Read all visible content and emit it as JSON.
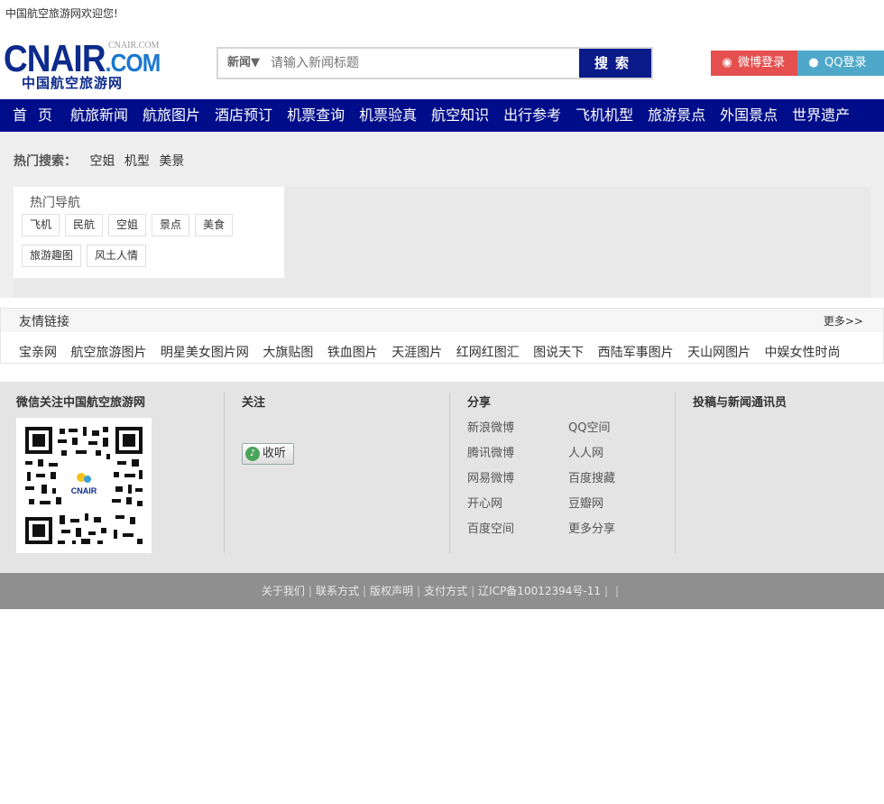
{
  "topbar": {
    "welcome": "中国航空旅游网欢迎您!"
  },
  "logo": {
    "main": "CNAIR",
    "dotcom": ".COM",
    "small": "CNAIR.COM",
    "cn": "中国航空旅游网"
  },
  "search": {
    "category": "新闻▼",
    "placeholder": "请输入新闻标题",
    "button": "搜索"
  },
  "login": {
    "weibo": "微博登录",
    "qq": "QQ登录"
  },
  "nav": [
    "首页",
    "航旅新闻",
    "航旅图片",
    "酒店预订",
    "机票查询",
    "机票验真",
    "航空知识",
    "出行参考",
    "飞机机型",
    "旅游景点",
    "外国景点",
    "世界遗产"
  ],
  "hot_search": {
    "label": "热门搜索：",
    "items": [
      "空姐",
      "机型",
      "美景"
    ]
  },
  "hot_nav": {
    "title": "热门导航",
    "tags": [
      "飞机",
      "民航",
      "空姐",
      "景点",
      "美食",
      "旅游趣图",
      "风土人情"
    ]
  },
  "links": {
    "title": "友情链接",
    "more": "更多>>",
    "items": [
      "宝亲网",
      "航空旅游图片",
      "明星美女图片网",
      "大旗贴图",
      "铁血图片",
      "天涯图片",
      "红网红图汇",
      "图说天下",
      "西陆军事图片",
      "天山网图片",
      "中娱女性时尚"
    ]
  },
  "footer": {
    "wechat_title": "微信关注中国航空旅游网",
    "qr_logo": "CNAIR",
    "follow_title": "关注",
    "listen": "收听",
    "share_title": "分享",
    "share": [
      "新浪微博",
      "QQ空间",
      "腾讯微博",
      "人人网",
      "网易微博",
      "百度搜藏",
      "开心网",
      "豆瓣网",
      "百度空间",
      "更多分享"
    ],
    "contribute_title": "投稿与新闻通讯员"
  },
  "bottom": {
    "items": [
      "关于我们",
      "联系方式",
      "版权声明",
      "支付方式",
      "辽ICP备10012394号-11"
    ],
    "sep": "|"
  },
  "colors": {
    "nav_bg": "#000d8a",
    "search_btn": "#0b1b8a",
    "weibo": "#e5504f",
    "qq": "#4fa8c9",
    "bottom_bg": "#8f8f8f"
  }
}
